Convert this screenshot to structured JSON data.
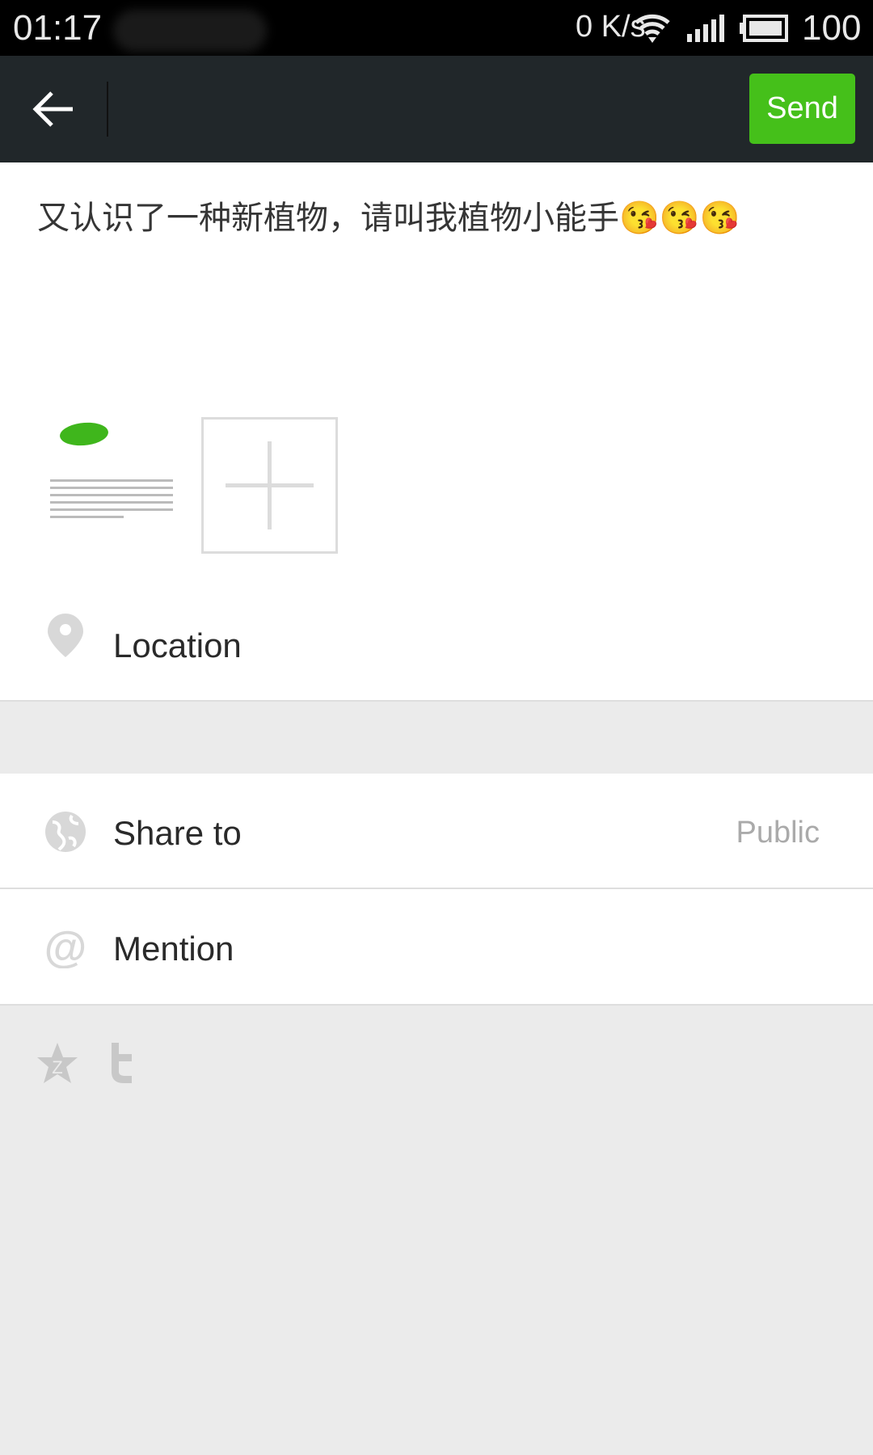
{
  "status_bar": {
    "time": "01:17",
    "net_speed": "0 K/s",
    "battery": "100"
  },
  "toolbar": {
    "send_label": "Send"
  },
  "post": {
    "text": "又认识了一种新植物，请叫我植物小能手😘😘😘"
  },
  "options": [
    {
      "label": "Location",
      "icon": "location-pin-icon"
    },
    {
      "label": "Share to",
      "value": "Public",
      "icon": "globe-icon"
    },
    {
      "label": "Mention",
      "icon": "at-icon"
    }
  ],
  "colors": {
    "accent": "#45c01a",
    "toolbar": "#21272a",
    "background": "#ebebeb"
  }
}
